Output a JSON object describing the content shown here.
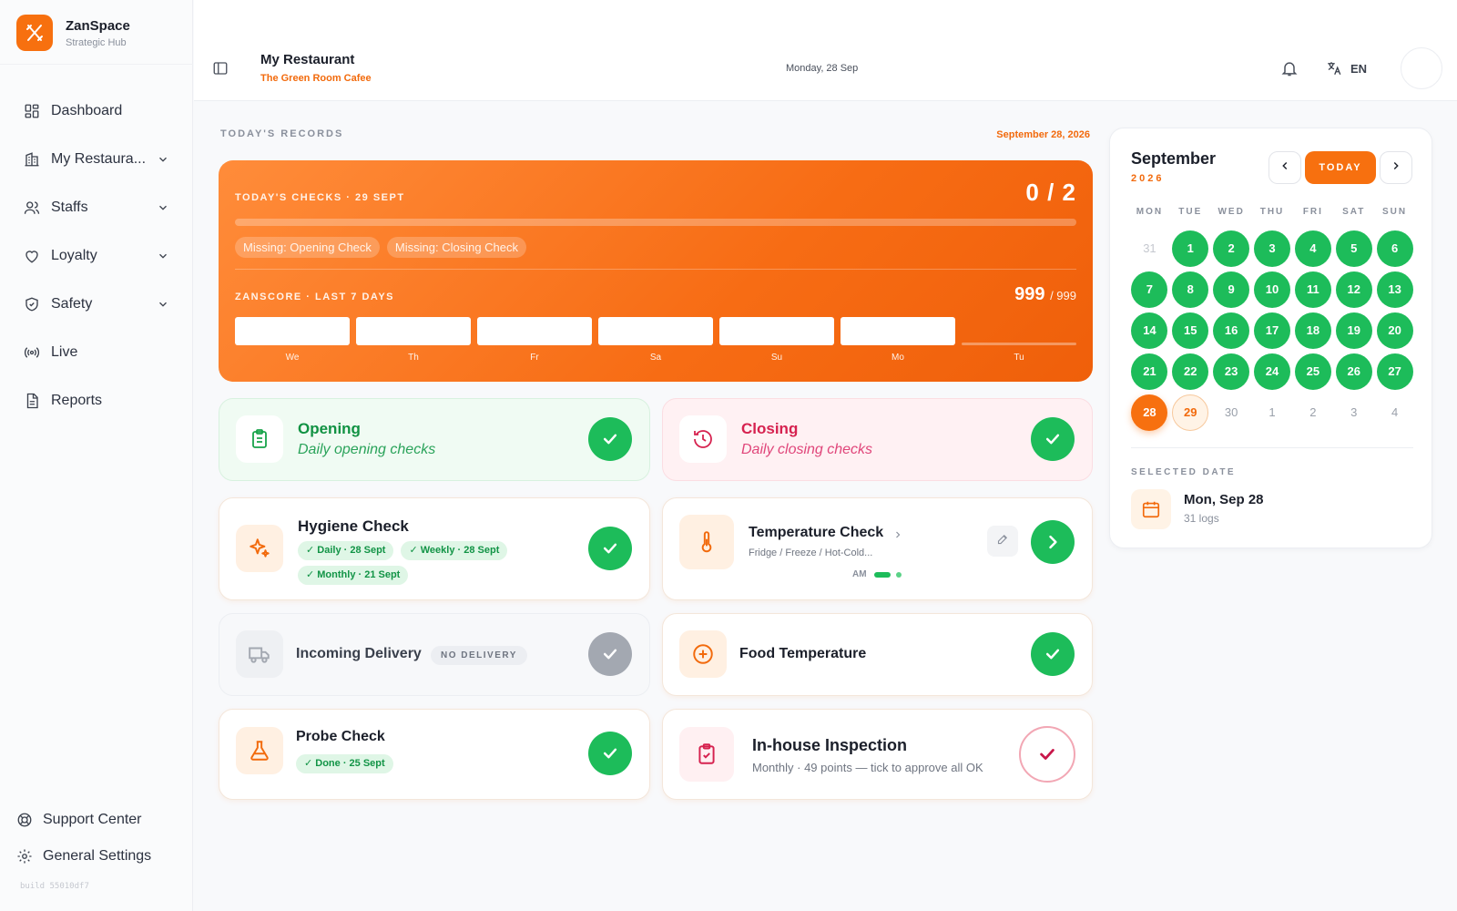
{
  "brand": {
    "name": "ZanSpace",
    "subtitle": "Strategic Hub"
  },
  "nav": {
    "items": [
      {
        "label": "Dashboard",
        "icon": "dashboard-icon"
      },
      {
        "label": "My Restaura...",
        "icon": "building-icon"
      },
      {
        "label": "Staffs",
        "icon": "users-icon"
      },
      {
        "label": "Loyalty",
        "icon": "heart-icon"
      },
      {
        "label": "Safety",
        "icon": "shield-icon"
      },
      {
        "label": "Live",
        "icon": "broadcast-icon"
      },
      {
        "label": "Reports",
        "icon": "document-icon"
      }
    ],
    "bottom": [
      {
        "label": "Support Center",
        "icon": "lifebuoy-icon"
      },
      {
        "label": "General Settings",
        "icon": "gear-icon"
      }
    ],
    "build": "build 55010df7"
  },
  "header": {
    "title": "My Restaurant",
    "subtitle": "The Green Room Cafee",
    "date": "Monday, 28 Sep",
    "language": "EN"
  },
  "records": {
    "heading": "TODAY'S RECORDS",
    "date": "September 28, 2026"
  },
  "banner": {
    "checks_label": "TODAY'S CHECKS · 29 SEPT",
    "checks_value": "0 / 2",
    "checks_done_fraction": 0,
    "missing": [
      "Missing: Opening Check",
      "Missing: Closing Check"
    ],
    "score_label": "ZANSCORE · LAST 7 DAYS",
    "score_value": "999",
    "score_max": "/ 999",
    "days": [
      {
        "label": "We",
        "filled": true
      },
      {
        "label": "Th",
        "filled": true
      },
      {
        "label": "Fr",
        "filled": true
      },
      {
        "label": "Sa",
        "filled": true
      },
      {
        "label": "Su",
        "filled": true
      },
      {
        "label": "Mo",
        "filled": true
      },
      {
        "label": "Tu",
        "filled": false
      }
    ]
  },
  "cards": {
    "opening": {
      "title": "Opening",
      "subtitle": "Daily opening checks",
      "status": "done"
    },
    "closing": {
      "title": "Closing",
      "subtitle": "Daily closing checks",
      "status": "done"
    },
    "hygiene": {
      "title": "Hygiene Check",
      "badges": [
        "✓ Daily · 28 Sept",
        "✓ Weekly · 28 Sept",
        "✓ Monthly · 21 Sept"
      ],
      "status": "done"
    },
    "temperature": {
      "title": "Temperature Check",
      "subtitle": "Fridge / Freeze / Hot-Cold...",
      "period_label": "AM"
    },
    "delivery": {
      "title": "Incoming Delivery",
      "badge": "NO DELIVERY",
      "status": "disabled"
    },
    "food_temp": {
      "title": "Food Temperature",
      "status": "done"
    },
    "probe": {
      "title": "Probe Check",
      "badge": "✓ Done · 25 Sept",
      "status": "done"
    },
    "inspection": {
      "title": "In-house Inspection",
      "subtitle": "Monthly · 49 points — tick to approve all OK"
    }
  },
  "calendar": {
    "month": "September",
    "year": "2026",
    "today_label": "TODAY",
    "weekdays": [
      "MON",
      "TUE",
      "WED",
      "THU",
      "FRI",
      "SAT",
      "SUN"
    ],
    "weeks": [
      [
        {
          "d": "31",
          "s": "muted"
        },
        {
          "d": "1",
          "s": "done"
        },
        {
          "d": "2",
          "s": "done"
        },
        {
          "d": "3",
          "s": "done"
        },
        {
          "d": "4",
          "s": "done"
        },
        {
          "d": "5",
          "s": "done"
        },
        {
          "d": "6",
          "s": "done"
        }
      ],
      [
        {
          "d": "7",
          "s": "done"
        },
        {
          "d": "8",
          "s": "done"
        },
        {
          "d": "9",
          "s": "done"
        },
        {
          "d": "10",
          "s": "done"
        },
        {
          "d": "11",
          "s": "done"
        },
        {
          "d": "12",
          "s": "done"
        },
        {
          "d": "13",
          "s": "done"
        }
      ],
      [
        {
          "d": "14",
          "s": "done"
        },
        {
          "d": "15",
          "s": "done"
        },
        {
          "d": "16",
          "s": "done"
        },
        {
          "d": "17",
          "s": "done"
        },
        {
          "d": "18",
          "s": "done"
        },
        {
          "d": "19",
          "s": "done"
        },
        {
          "d": "20",
          "s": "done"
        }
      ],
      [
        {
          "d": "21",
          "s": "done"
        },
        {
          "d": "22",
          "s": "done"
        },
        {
          "d": "23",
          "s": "done"
        },
        {
          "d": "24",
          "s": "done"
        },
        {
          "d": "25",
          "s": "done"
        },
        {
          "d": "26",
          "s": "done"
        },
        {
          "d": "27",
          "s": "done"
        }
      ],
      [
        {
          "d": "28",
          "s": "selected"
        },
        {
          "d": "29",
          "s": "today"
        },
        {
          "d": "30",
          "s": "future"
        },
        {
          "d": "1",
          "s": "future"
        },
        {
          "d": "2",
          "s": "future"
        },
        {
          "d": "3",
          "s": "future"
        },
        {
          "d": "4",
          "s": "future"
        }
      ]
    ],
    "selected_label": "SELECTED DATE",
    "selected_date": "Mon, Sep 28",
    "selected_logs": "31 logs"
  },
  "colors": {
    "accent": "#f7700f",
    "success": "#1dbc5a",
    "closing": "#d6224f"
  }
}
